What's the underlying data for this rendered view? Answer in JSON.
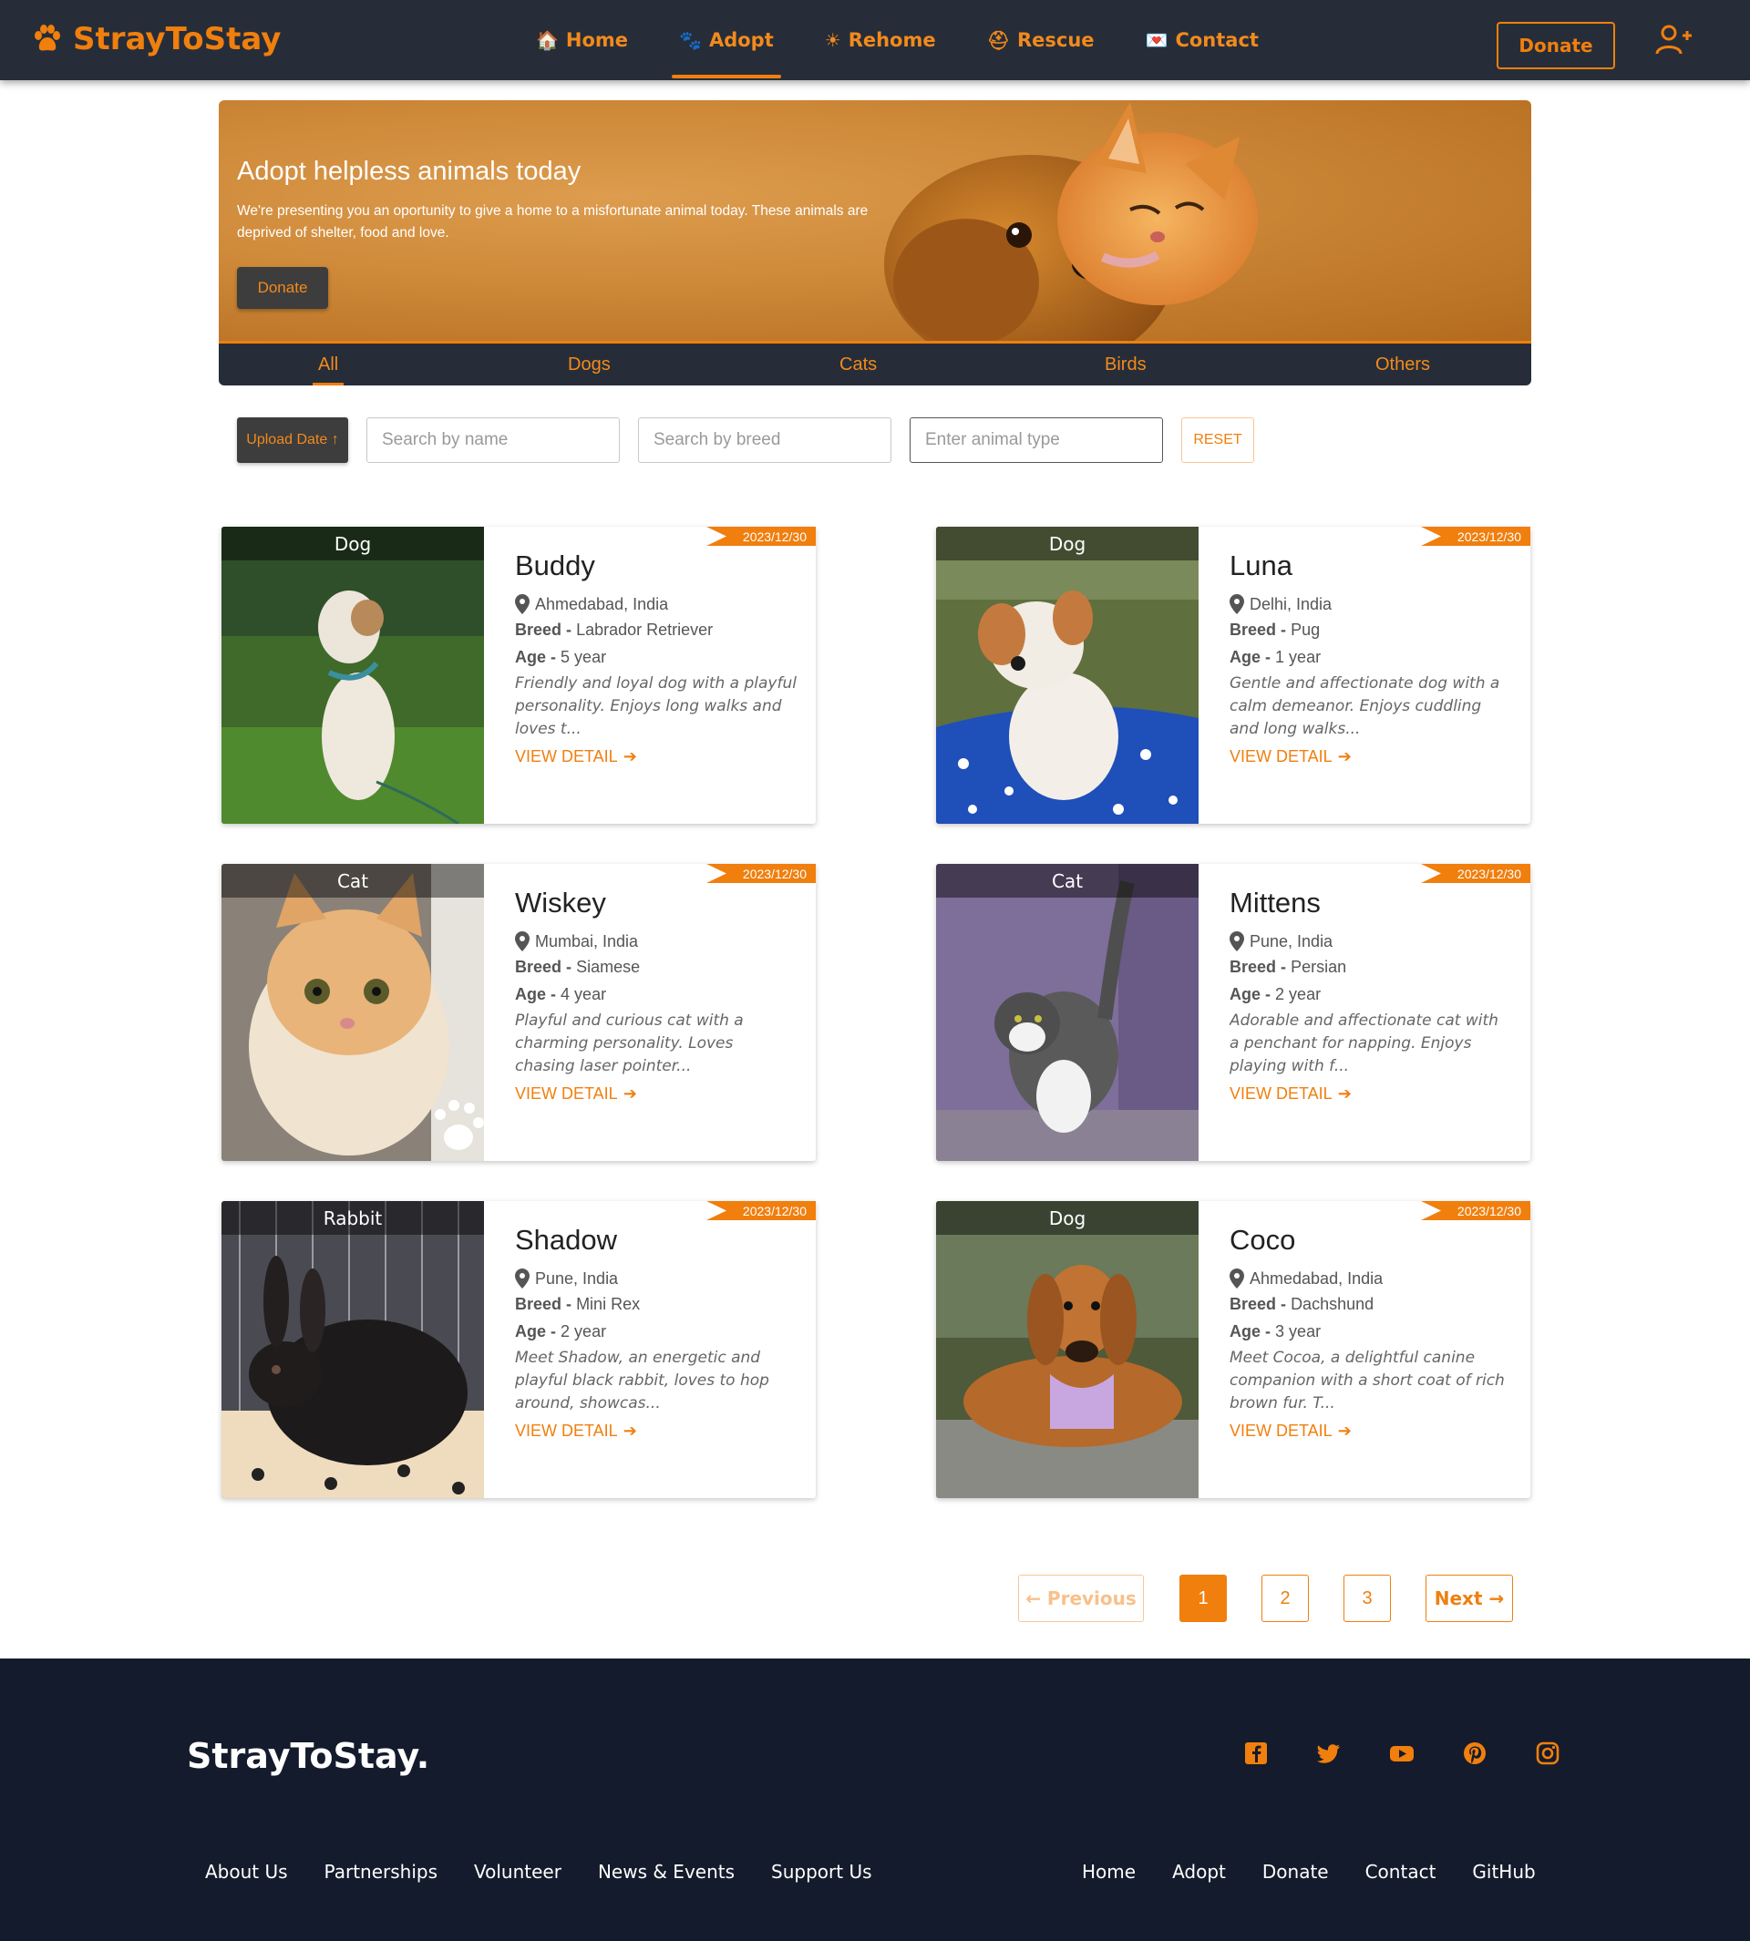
{
  "brand": "StrayToStay",
  "nav": {
    "links": [
      {
        "label": "Home",
        "glyph": "🏠"
      },
      {
        "label": "Adopt",
        "glyph": "🐾"
      },
      {
        "label": "Rehome",
        "glyph": "☀"
      },
      {
        "label": "Rescue",
        "glyph": "⛑"
      },
      {
        "label": "Contact",
        "glyph": "💌"
      }
    ],
    "active": "Adopt",
    "donate": "Donate",
    "user_icon": "user-plus-icon"
  },
  "hero": {
    "title": "Adopt helpless animals today",
    "text": "We're presenting you an oportunity to give a home to a misfortunate animal today. These animals are deprived of shelter, food and love.",
    "button": "Donate"
  },
  "tabs": [
    "All",
    "Dogs",
    "Cats",
    "Birds",
    "Others"
  ],
  "active_tab": "All",
  "filters": {
    "sort_label": "Upload Date ↑",
    "name_placeholder": "Search by name",
    "breed_placeholder": "Search by breed",
    "type_placeholder": "Enter animal type",
    "reset": "RESET"
  },
  "pets": [
    {
      "type": "Dog",
      "date": "2023/12/30",
      "name": "Buddy",
      "location": "Ahmedabad, India",
      "breed_label": "Breed",
      "breed": "Labrador Retriever",
      "age_label": "Age",
      "age": "5 year",
      "desc": "Friendly and loyal dog with a playful personality. Enjoys long walks and loves t...",
      "cta": "VIEW DETAIL"
    },
    {
      "type": "Dog",
      "date": "2023/12/30",
      "name": "Luna",
      "location": "Delhi, India",
      "breed_label": "Breed",
      "breed": "Pug",
      "age_label": "Age",
      "age": "1 year",
      "desc": "Gentle and affectionate dog with a calm demeanor. Enjoys cuddling and long walks...",
      "cta": "VIEW DETAIL"
    },
    {
      "type": "Cat",
      "date": "2023/12/30",
      "name": "Wiskey",
      "location": "Mumbai, India",
      "breed_label": "Breed",
      "breed": "Siamese",
      "age_label": "Age",
      "age": "4 year",
      "desc": "Playful and curious cat with a charming personality. Loves chasing laser pointer...",
      "cta": "VIEW DETAIL"
    },
    {
      "type": "Cat",
      "date": "2023/12/30",
      "name": "Mittens",
      "location": "Pune, India",
      "breed_label": "Breed",
      "breed": "Persian",
      "age_label": "Age",
      "age": "2 year",
      "desc": "Adorable and affectionate cat with a penchant for napping. Enjoys playing with f...",
      "cta": "VIEW DETAIL"
    },
    {
      "type": "Rabbit",
      "date": "2023/12/30",
      "name": "Shadow",
      "location": "Pune, India",
      "breed_label": "Breed",
      "breed": "Mini Rex",
      "age_label": "Age",
      "age": "2 year",
      "desc": "Meet Shadow, an energetic and playful black rabbit, loves to hop around, showcas...",
      "cta": "VIEW DETAIL"
    },
    {
      "type": "Dog",
      "date": "2023/12/30",
      "name": "Coco",
      "location": "Ahmedabad, India",
      "breed_label": "Breed",
      "breed": "Dachshund",
      "age_label": "Age",
      "age": "3 year",
      "desc": "Meet Cocoa, a delightful canine companion with a short coat of rich brown fur. T...",
      "cta": "VIEW DETAIL"
    }
  ],
  "pagination": {
    "prev": "← Previous",
    "pages": [
      "1",
      "2",
      "3"
    ],
    "current": "1",
    "next": "Next →"
  },
  "footer": {
    "brand": "StrayToStay.",
    "socials": [
      "facebook-icon",
      "twitter-icon",
      "youtube-icon",
      "pinterest-icon",
      "instagram-icon"
    ],
    "left_links": [
      "About Us",
      "Partnerships",
      "Volunteer",
      "News & Events",
      "Support Us"
    ],
    "right_links": [
      "Home",
      "Adopt",
      "Donate",
      "Contact",
      "GitHub"
    ]
  },
  "colors": {
    "accent": "#f07f0e",
    "nav_bg": "#262d38",
    "footer_bg": "#141b2c"
  }
}
